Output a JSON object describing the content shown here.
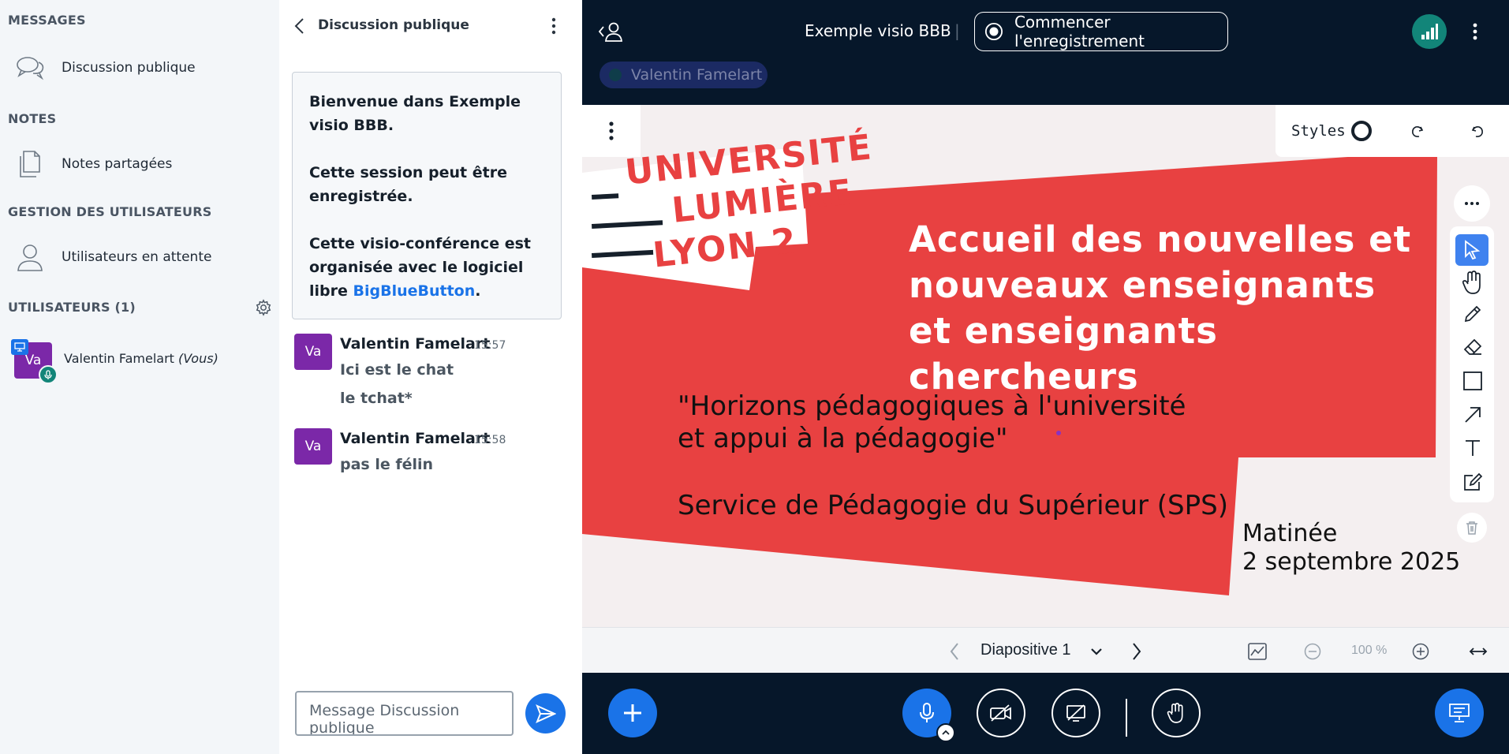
{
  "sidebar": {
    "messages_title": "MESSAGES",
    "public_chat": "Discussion publique",
    "notes_title": "NOTES",
    "shared_notes": "Notes partagées",
    "user_mgmt_title": "GESTION DES UTILISATEURS",
    "waiting_users": "Utilisateurs en attente",
    "users_title": "UTILISATEURS (1)",
    "user": {
      "initials": "Va",
      "name": "Valentin Famelart",
      "you": "(Vous)"
    }
  },
  "chat": {
    "title": "Discussion publique",
    "welcome": {
      "line1": "Bienvenue dans Exemple visio BBB.",
      "line2": "Cette session peut être enregistrée.",
      "line3_prefix": "Cette visio-conférence est organisée avec le logiciel libre ",
      "link": "BigBlueButton",
      "line3_suffix": "."
    },
    "messages": [
      {
        "initials": "Va",
        "name": "Valentin Famelart",
        "time": "15:57",
        "lines": [
          "Ici est le chat",
          "le tchat*"
        ]
      },
      {
        "initials": "Va",
        "name": "Valentin Famelart",
        "time": "15:58",
        "lines": [
          "pas le félin"
        ]
      }
    ],
    "input_placeholder": "Message Discussion publique"
  },
  "topbar": {
    "title": "Exemple visio BBB",
    "separator": "|",
    "record_label": "Commencer l'enregistrement",
    "speaker": "Valentin Famelart"
  },
  "whiteboard": {
    "styles_label": "Styles"
  },
  "slide": {
    "logo_line1": "UNIVERSITÉ",
    "logo_line2": "LUMIÈRE",
    "logo_line3": "LYON 2",
    "heading": [
      "Accueil des nouvelles et",
      "nouveaux enseignants",
      "et enseignants",
      "chercheurs"
    ],
    "quote_line1": "\"Horizons pédagogiques à l'université",
    "quote_line2": "et appui à la pédagogie\"",
    "service": "Service de Pédagogie du Supérieur (SPS)",
    "session": "Matinée",
    "date": "2 septembre 2025",
    "colors": {
      "red": "#e84141",
      "bg": "#f4eff0"
    }
  },
  "slide_nav": {
    "current": "Diapositive 1",
    "zoom": "100 %"
  },
  "colors": {
    "accent": "#1a73e8",
    "dark_bg": "#06172a",
    "avatar": "#7b28a8",
    "connection": "#128579"
  }
}
